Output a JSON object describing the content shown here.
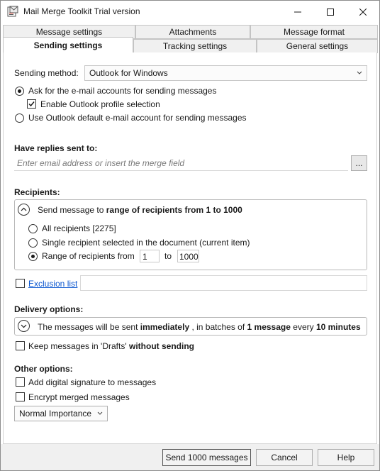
{
  "window": {
    "title": "Mail Merge Toolkit Trial version"
  },
  "tabs": {
    "row1": [
      "Message settings",
      "Attachments",
      "Message format"
    ],
    "row2": [
      "Sending settings",
      "Tracking settings",
      "General settings"
    ],
    "active": "Sending settings"
  },
  "sending": {
    "method_label": "Sending method:",
    "method_value": "Outlook for Windows",
    "ask_accounts_label": "Ask for the e-mail accounts for sending messages",
    "enable_profile_label": "Enable Outlook profile selection",
    "use_default_label": "Use Outlook default e-mail account for sending messages"
  },
  "replies": {
    "label": "Have replies sent to:",
    "placeholder": "Enter email address or insert the merge field",
    "browse_label": "..."
  },
  "recipients": {
    "label": "Recipients:",
    "summary_prefix": "Send message to",
    "summary_bold": "range of recipients from 1 to 1000",
    "all_label": "All recipients [2275]",
    "single_label": "Single recipient selected in the document (current item)",
    "range_label": "Range of recipients from",
    "range_from": "1",
    "range_to_label": "to",
    "range_to": "1000"
  },
  "exclusion": {
    "link_label": "Exclusion list"
  },
  "delivery": {
    "label": "Delivery options:",
    "text_1": "The messages will be sent",
    "bold_1": "immediately",
    "text_2": ", in batches of",
    "bold_2": "1 message",
    "text_3": "every",
    "bold_3": "10 minutes",
    "drafts_prefix": "Keep messages in 'Drafts'",
    "drafts_bold": "without sending"
  },
  "other": {
    "label": "Other options:",
    "signature_label": "Add digital signature to messages",
    "encrypt_label": "Encrypt merged messages",
    "importance_value": "Normal Importance"
  },
  "footer": {
    "send_label": "Send 1000 messages",
    "cancel_label": "Cancel",
    "help_label": "Help"
  }
}
